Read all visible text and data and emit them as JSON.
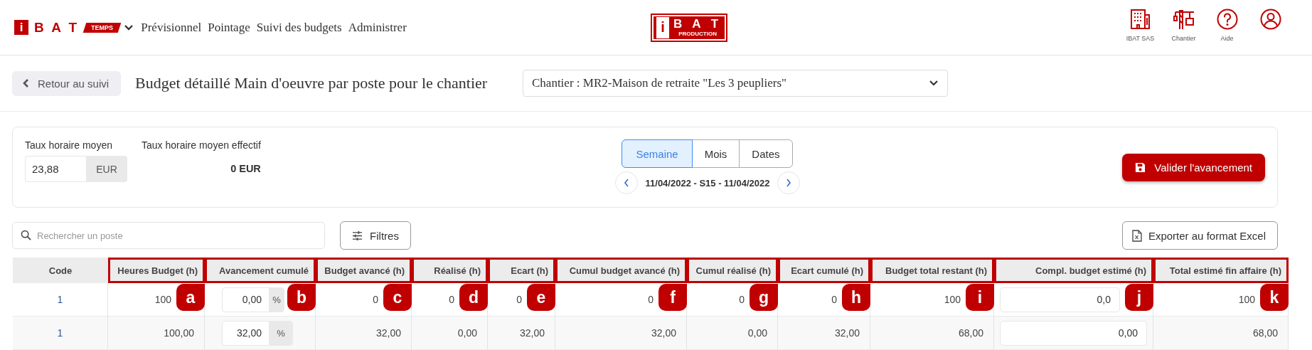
{
  "header": {
    "logo": {
      "letter": "i",
      "name": "B A T",
      "tag": "TEMPS"
    },
    "nav": [
      "Prévisionnel",
      "Pointage",
      "Suivi des budgets",
      "Administrer"
    ],
    "center_logo": {
      "letter": "i",
      "name": "B A T",
      "tag": "PRODUCTION"
    },
    "shortcuts": [
      {
        "kind": "building",
        "label": "IBAT SAS"
      },
      {
        "kind": "crane",
        "label": "Chantier"
      },
      {
        "kind": "help",
        "label": "Aide"
      },
      {
        "kind": "user"
      }
    ]
  },
  "toolbar": {
    "back_button": "Retour au suivi",
    "title": "Budget détaillé Main d'oeuvre par poste pour le chantier",
    "chantier_select": "Chantier : MR2-Maison de retraite \"Les 3 peupliers\""
  },
  "summary": {
    "rate_label": "Taux horaire moyen",
    "rate_value": "23,88",
    "rate_unit": "EUR",
    "effective_label": "Taux horaire moyen effectif",
    "effective_value": "0 EUR",
    "periods": [
      {
        "label": "Semaine",
        "selected": true
      },
      {
        "label": "Mois",
        "selected": false
      },
      {
        "label": "Dates",
        "selected": false
      }
    ],
    "period_range": "11/04/2022 - S15 - 11/04/2022",
    "validate_button": "Valider l'avancement"
  },
  "search": {
    "placeholder": "Rechercher un poste"
  },
  "filters_button": "Filtres",
  "export_button": "Exporter au format Excel",
  "table": {
    "columns": [
      {
        "label": "Code"
      },
      {
        "label": "Heures Budget (h)",
        "annotation": "a"
      },
      {
        "label": "Avancement cumulé",
        "annotation": "b"
      },
      {
        "label": "Budget avancé (h)",
        "annotation": "c"
      },
      {
        "label": "Réalisé (h)",
        "annotation": "d"
      },
      {
        "label": "Ecart (h)",
        "annotation": "e"
      },
      {
        "label": "Cumul budget avancé (h)",
        "annotation": "f"
      },
      {
        "label": "Cumul réalisé (h)",
        "annotation": "g"
      },
      {
        "label": "Ecart cumulé (h)",
        "annotation": "h"
      },
      {
        "label": "Budget total restant (h)",
        "annotation": "i"
      },
      {
        "label": "Compl. budget estimé (h)",
        "annotation": "j"
      },
      {
        "label": "Total estimé fin affaire (h)",
        "annotation": "k"
      }
    ],
    "rows": [
      {
        "cells": [
          {
            "kind": "code",
            "value": "1"
          },
          {
            "kind": "text",
            "value": "100"
          },
          {
            "kind": "percent",
            "value": "0,00",
            "unit": "%"
          },
          {
            "kind": "text",
            "value": "0"
          },
          {
            "kind": "text",
            "value": "0"
          },
          {
            "kind": "text",
            "value": "0"
          },
          {
            "kind": "text",
            "value": "0"
          },
          {
            "kind": "text",
            "value": "0"
          },
          {
            "kind": "text",
            "value": "0"
          },
          {
            "kind": "text",
            "value": "100"
          },
          {
            "kind": "input",
            "value": "0,0"
          },
          {
            "kind": "text",
            "value": "100"
          }
        ]
      },
      {
        "cells": [
          {
            "kind": "code",
            "value": "1"
          },
          {
            "kind": "text",
            "value": "100,00"
          },
          {
            "kind": "percent",
            "value": "32,00",
            "unit": "%"
          },
          {
            "kind": "text",
            "value": "32,00"
          },
          {
            "kind": "text",
            "value": "0,00"
          },
          {
            "kind": "text",
            "value": "32,00"
          },
          {
            "kind": "text",
            "value": "32,00"
          },
          {
            "kind": "text",
            "value": "0,00"
          },
          {
            "kind": "text",
            "value": "32,00"
          },
          {
            "kind": "text",
            "value": "68,00"
          },
          {
            "kind": "input",
            "value": "0,00"
          },
          {
            "kind": "text",
            "value": "68,00"
          }
        ]
      }
    ]
  }
}
